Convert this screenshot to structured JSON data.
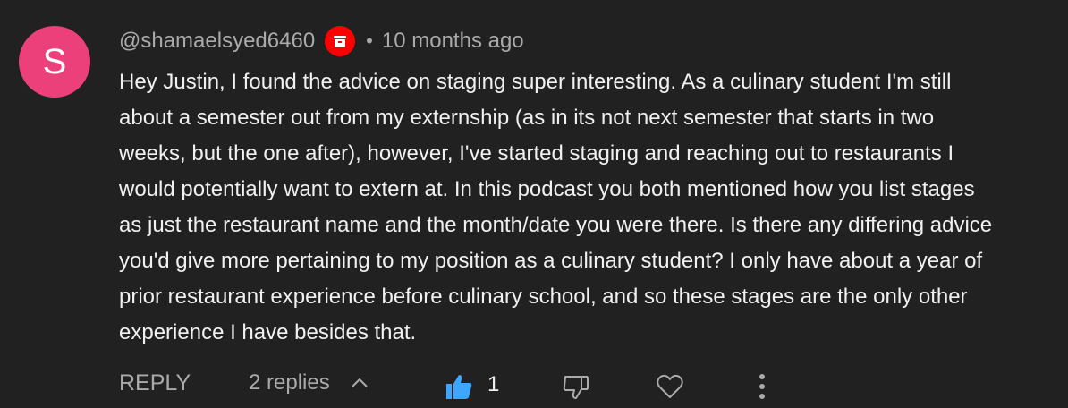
{
  "comment": {
    "avatar_letter": "S",
    "avatar_color": "#ec407a",
    "author": "@shamaelsyed6460",
    "badge_icon": "membership-badge-icon",
    "separator": "•",
    "time": "10 months ago",
    "text": "Hey Justin, I found the advice on staging super interesting. As a culinary student I'm still\nabout a semester out from my externship (as in its not next semester that starts in two\nweeks, but the one after), however, I've started staging and reaching out to restaurants I\nwould potentially want to extern at. In this podcast you both mentioned how you list stages\nas just the restaurant name and the month/date you were there. Is there any differing advice\nyou'd give more pertaining to my position as a culinary student? I only have about a year of\nprior restaurant experience before culinary school, and so these stages are the only other\nexperience I have besides that."
  },
  "actions": {
    "reply_label": "REPLY",
    "replies_label": "2 replies",
    "like_count": "1",
    "like_active_color": "#3ea6ff",
    "icons": [
      "thumbs-up-icon",
      "thumbs-down-icon",
      "heart-icon",
      "more-vert-icon",
      "chevron-up-icon"
    ]
  }
}
